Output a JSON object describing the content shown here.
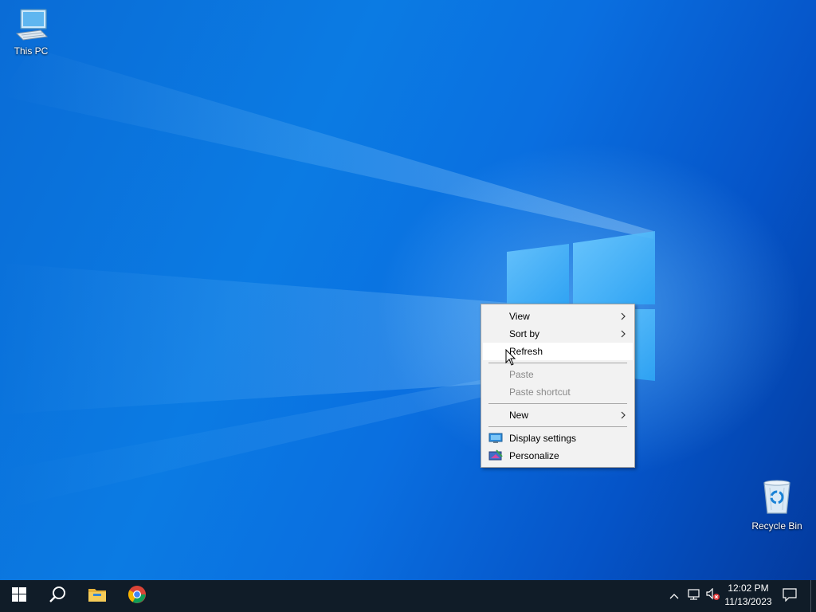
{
  "desktop": {
    "icons": [
      {
        "label": "This PC",
        "icon": "this-pc-icon"
      },
      {
        "label": "Recycle Bin",
        "icon": "recycle-bin-icon"
      }
    ]
  },
  "context_menu": {
    "items": [
      {
        "label": "View",
        "has_submenu": true,
        "enabled": true
      },
      {
        "label": "Sort by",
        "has_submenu": true,
        "enabled": true
      },
      {
        "label": "Refresh",
        "has_submenu": false,
        "enabled": true,
        "highlighted": true
      },
      {
        "label": "Paste",
        "has_submenu": false,
        "enabled": false
      },
      {
        "label": "Paste shortcut",
        "has_submenu": false,
        "enabled": false
      },
      {
        "label": "New",
        "has_submenu": true,
        "enabled": true
      },
      {
        "label": "Display settings",
        "has_submenu": false,
        "enabled": true,
        "icon": "display-settings-icon"
      },
      {
        "label": "Personalize",
        "has_submenu": false,
        "enabled": true,
        "icon": "personalize-icon"
      }
    ]
  },
  "taskbar": {
    "apps": [
      {
        "name": "start-button",
        "icon": "windows-logo-icon"
      },
      {
        "name": "search-button",
        "icon": "search-icon"
      },
      {
        "name": "file-explorer-button",
        "icon": "folder-icon"
      },
      {
        "name": "chrome-button",
        "icon": "chrome-icon"
      }
    ],
    "tray": {
      "time": "12:02 PM",
      "date": "11/13/2023",
      "icons": [
        "chevron-up-icon",
        "network-icon",
        "volume-muted-icon",
        "notifications-icon"
      ]
    }
  },
  "colors": {
    "taskbar": "#101c28",
    "menu_background": "#f2f2f2",
    "desktop_accent": "#0a78e0"
  }
}
